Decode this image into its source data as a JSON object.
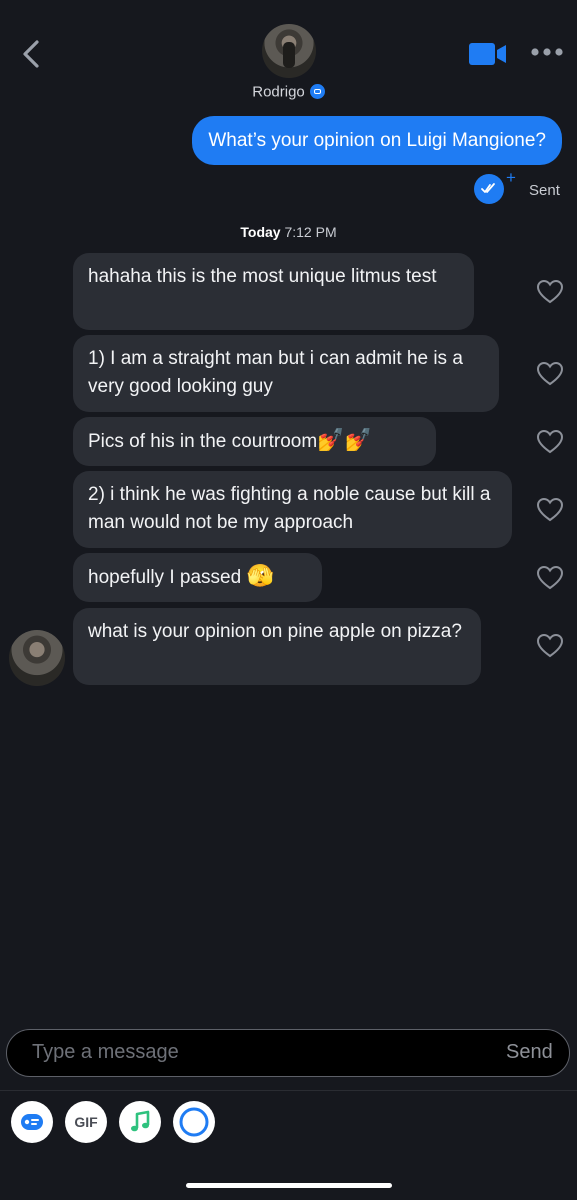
{
  "header": {
    "name": "Rodrigo",
    "back_icon": "chevron-left-icon",
    "video_icon": "video-camera-icon",
    "more_icon": "ellipsis-icon"
  },
  "sent_message": {
    "text": "What’s your opinion on Luigi Mangione?",
    "status": "Sent",
    "status_plus": "+"
  },
  "timestamp": {
    "day": "Today",
    "time": "7:12 PM"
  },
  "received": [
    {
      "text": "hahaha this is the most unique litmus test"
    },
    {
      "text": "1) I am a straight man but i can admit he is a very good looking guy"
    },
    {
      "text": "Pics of his in the courtroom",
      "emoji": "💅💅"
    },
    {
      "text": "2) i think he was fighting a noble cause but kill a man would not be my approach"
    },
    {
      "text": "hopefully I passed ",
      "emoji": "🫣"
    },
    {
      "text": "what is your opinion on pine apple on pizza?"
    }
  ],
  "composer": {
    "placeholder": "Type a message",
    "send_label": "Send"
  },
  "toolbar": {
    "gif_label": "GIF",
    "items": [
      "sticker-icon",
      "gif-icon",
      "music-note-icon",
      "loop-icon"
    ]
  },
  "colors": {
    "background": "#16181e",
    "accent": "#1f7cf3",
    "bubble_received": "#2b2e35"
  }
}
